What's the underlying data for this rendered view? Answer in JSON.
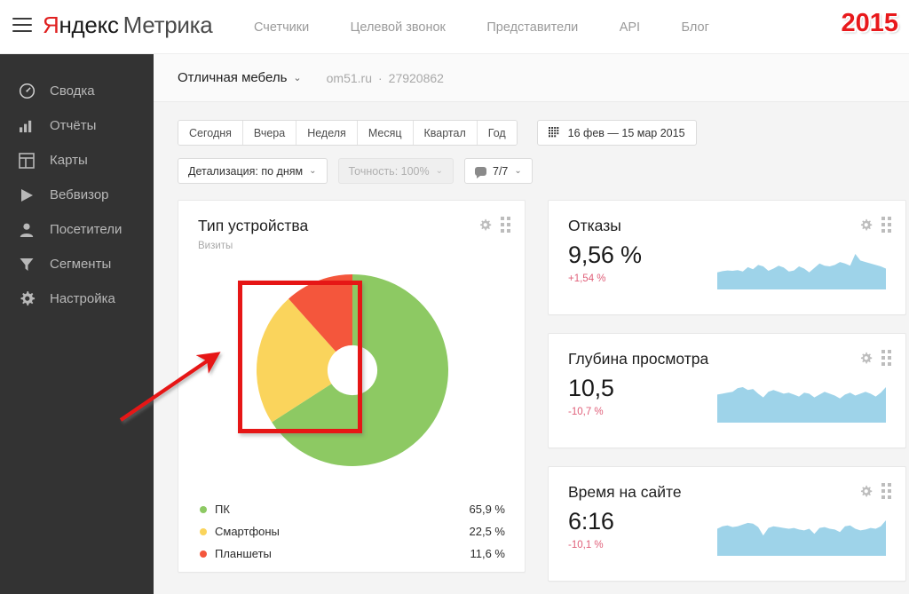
{
  "header": {
    "menu_icon": "burger-icon",
    "logo_ya": "Я",
    "logo_ya_rest": "ндекс",
    "logo_product": "Метрика",
    "year_badge": "2015",
    "nav": [
      {
        "label": "Счетчики"
      },
      {
        "label": "Целевой звонок"
      },
      {
        "label": "Представители"
      },
      {
        "label": "API"
      },
      {
        "label": "Блог"
      }
    ]
  },
  "sidebar": {
    "items": [
      {
        "label": "Сводка",
        "icon": "speedometer-icon"
      },
      {
        "label": "Отчёты",
        "icon": "bar-chart-icon"
      },
      {
        "label": "Карты",
        "icon": "layout-map-icon"
      },
      {
        "label": "Вебвизор",
        "icon": "play-icon"
      },
      {
        "label": "Посетители",
        "icon": "user-icon"
      },
      {
        "label": "Сегменты",
        "icon": "funnel-icon"
      },
      {
        "label": "Настройка",
        "icon": "gear-icon"
      }
    ]
  },
  "sitebar": {
    "site_name": "Отличная мебель",
    "caret": "⌄",
    "domain": "om51.ru",
    "separator": "·",
    "counter_id": "27920862"
  },
  "filters": {
    "periods": [
      {
        "label": "Сегодня"
      },
      {
        "label": "Вчера"
      },
      {
        "label": "Неделя"
      },
      {
        "label": "Месяц"
      },
      {
        "label": "Квартал"
      },
      {
        "label": "Год"
      }
    ],
    "date_range": "16 фев — 15 мар 2015",
    "date_icon": "calendar-icon",
    "detail": {
      "label": "Детализация: по дням",
      "caret": "⌄"
    },
    "accuracy": {
      "label": "Точность: 100%",
      "caret": "⌄"
    },
    "goals": {
      "label": "7/7",
      "caret": "⌄",
      "icon": "comment-icon"
    }
  },
  "pie_card": {
    "title": "Тип устройства",
    "subtitle": "Визиты",
    "gear_icon": "gear-icon",
    "grid_icon": "drag-grid-icon"
  },
  "metric_cards": [
    {
      "title": "Отказы",
      "value": "9,56 %",
      "delta": "+1,54 %",
      "gear_icon": "gear-icon",
      "grid_icon": "drag-grid-icon"
    },
    {
      "title": "Глубина просмотра",
      "value": "10,5",
      "delta": "-10,7 %",
      "gear_icon": "gear-icon",
      "grid_icon": "drag-grid-icon"
    },
    {
      "title": "Время на сайте",
      "value": "6:16",
      "delta": "-10,1 %",
      "gear_icon": "gear-icon",
      "grid_icon": "drag-grid-icon"
    }
  ],
  "colors": {
    "pc": "#8dc963",
    "smartphone": "#fad45c",
    "tablet": "#f4563c",
    "sparkline": "#9ed3e9",
    "delta_negative": "#e0607a",
    "accent_red": "#e61616",
    "sidebar_bg": "#333333"
  },
  "annotation": {
    "shape": "red-rectangle-highlight",
    "arrow": "red-arrow-pointing-to-highlight"
  },
  "chart_data": {
    "type": "pie",
    "title": "Тип устройства",
    "subtitle": "Визиты",
    "labels": [
      "ПК",
      "Смартфоны",
      "Планшеты"
    ],
    "values": [
      65.9,
      22.5,
      11.6
    ],
    "value_labels": [
      "65,9 %",
      "22,5 %",
      "11,6 %"
    ],
    "colors": [
      "#8dc963",
      "#fad45c",
      "#f4563c"
    ],
    "donut": true,
    "inner_radius_ratio": 0.26,
    "start_angle_deg": 0,
    "direction": "clockwise",
    "legend_position": "bottom",
    "sparklines": [
      {
        "name": "Отказы",
        "values": [
          42,
          45,
          47,
          46,
          48,
          44,
          56,
          50,
          62,
          58,
          46,
          52,
          60,
          55,
          44,
          47,
          58,
          52,
          42,
          54,
          66,
          60,
          58,
          62,
          70,
          66,
          60,
          92,
          74,
          70,
          66,
          62,
          58,
          52
        ]
      },
      {
        "name": "Глубина просмотра",
        "values": [
          56,
          58,
          60,
          62,
          70,
          72,
          66,
          68,
          58,
          50,
          62,
          66,
          62,
          58,
          60,
          56,
          52,
          60,
          58,
          50,
          56,
          62,
          58,
          54,
          48,
          56,
          60,
          54,
          58,
          62,
          58,
          52,
          60,
          72
        ]
      },
      {
        "name": "Время на сайте",
        "values": [
          60,
          66,
          68,
          64,
          66,
          70,
          74,
          72,
          64,
          44,
          62,
          66,
          64,
          62,
          60,
          62,
          58,
          56,
          60,
          48,
          62,
          64,
          60,
          58,
          52,
          66,
          68,
          60,
          56,
          58,
          62,
          60,
          66,
          80
        ]
      }
    ]
  }
}
